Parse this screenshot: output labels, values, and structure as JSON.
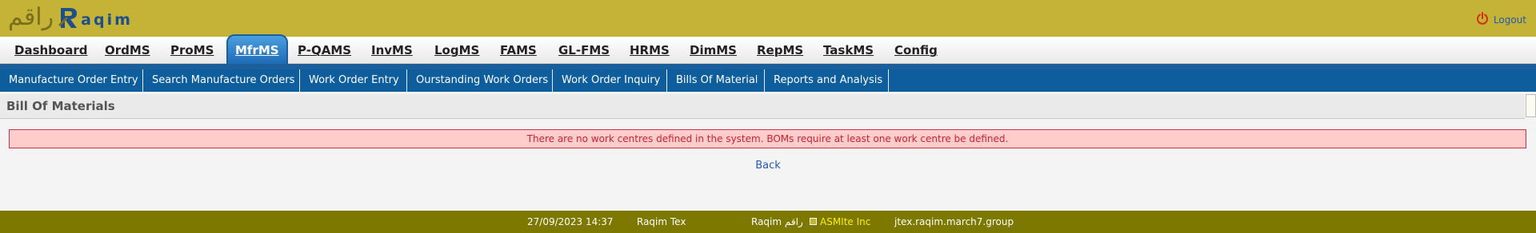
{
  "header": {
    "logo_arabic": "راقم",
    "logo_latin": "aqim",
    "logout_label": "Logout",
    "logout_icon": "power-icon"
  },
  "main_tabs": [
    {
      "label": "Dashboard",
      "active": false
    },
    {
      "label": "OrdMS",
      "active": false
    },
    {
      "label": "ProMS",
      "active": false
    },
    {
      "label": "MfrMS",
      "active": true
    },
    {
      "label": "P-QAMS",
      "active": false
    },
    {
      "label": "InvMS",
      "active": false
    },
    {
      "label": "LogMS",
      "active": false
    },
    {
      "label": "FAMS",
      "active": false
    },
    {
      "label": "GL-FMS",
      "active": false
    },
    {
      "label": "HRMS",
      "active": false
    },
    {
      "label": "DimMS",
      "active": false
    },
    {
      "label": "RepMS",
      "active": false
    },
    {
      "label": "TaskMS",
      "active": false
    },
    {
      "label": "Config",
      "active": false
    }
  ],
  "sub_nav": [
    "Manufacture Order Entry",
    "Search Manufacture Orders",
    "Work Order Entry",
    "Ourstanding Work Orders",
    "Work Order Inquiry",
    "Bills Of Material",
    "Reports and Analysis"
  ],
  "page": {
    "title": "Bill Of Materials",
    "error_message": "There are no work centres defined in the system. BOMs require at least one work centre be defined.",
    "back_label": "Back"
  },
  "footer": {
    "datetime": "27/09/2023 14:37",
    "company": "Raqim Tex",
    "brand": "Raqim راقم",
    "powered_by": "ASMIte Inc",
    "host": "jtex.raqim.march7.group"
  },
  "colors": {
    "header_bg": "#c4b337",
    "nav_blue": "#0e5d9c",
    "footer_bg": "#7c7800",
    "error_bg": "#ffcccc",
    "error_text": "#cc2233",
    "accent_yellow": "#ffee00"
  }
}
